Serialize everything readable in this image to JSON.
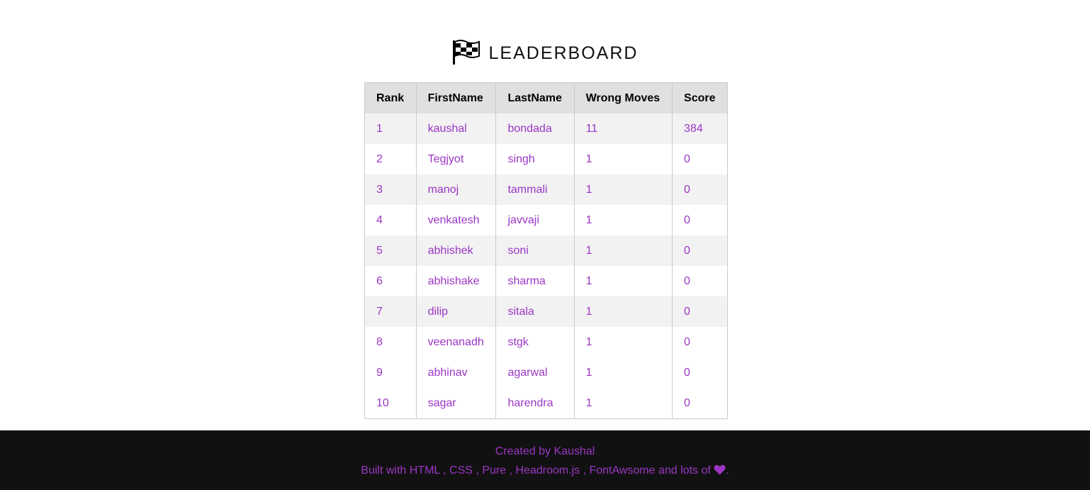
{
  "heading": {
    "icon": "checkered-flag-icon",
    "title": "LEADERBOARD"
  },
  "table": {
    "columns": [
      "Rank",
      "FirstName",
      "LastName",
      "Wrong Moves",
      "Score"
    ],
    "rows": [
      {
        "rank": "1",
        "first": "kaushal",
        "last": "bondada",
        "wrong": "11",
        "score": "384"
      },
      {
        "rank": "2",
        "first": "Tegjyot",
        "last": "singh",
        "wrong": "1",
        "score": "0"
      },
      {
        "rank": "3",
        "first": "manoj",
        "last": "tammali",
        "wrong": "1",
        "score": "0"
      },
      {
        "rank": "4",
        "first": "venkatesh",
        "last": "javvaji",
        "wrong": "1",
        "score": "0"
      },
      {
        "rank": "5",
        "first": "abhishek",
        "last": "soni",
        "wrong": "1",
        "score": "0"
      },
      {
        "rank": "6",
        "first": "abhishake",
        "last": "sharma",
        "wrong": "1",
        "score": "0"
      },
      {
        "rank": "7",
        "first": "dilip",
        "last": "sitala",
        "wrong": "1",
        "score": "0"
      },
      {
        "rank": "8",
        "first": "veenanadh",
        "last": "stgk",
        "wrong": "1",
        "score": "0"
      },
      {
        "rank": "9",
        "first": "abhinav",
        "last": "agarwal",
        "wrong": "1",
        "score": "0"
      },
      {
        "rank": "10",
        "first": "sagar",
        "last": "harendra",
        "wrong": "1",
        "score": "0"
      }
    ]
  },
  "footer": {
    "line1": "Created by Kaushal",
    "line2_prefix": "Built with HTML , CSS , Pure , Headroom.js , FontAwsome and lots of ",
    "line2_suffix": ".",
    "heart_icon": "heart-icon"
  },
  "colors": {
    "accent": "#9b36c4",
    "footer_bg": "#111111",
    "header_row_bg": "#e0e0e0",
    "odd_row_bg": "#f2f2f2"
  }
}
